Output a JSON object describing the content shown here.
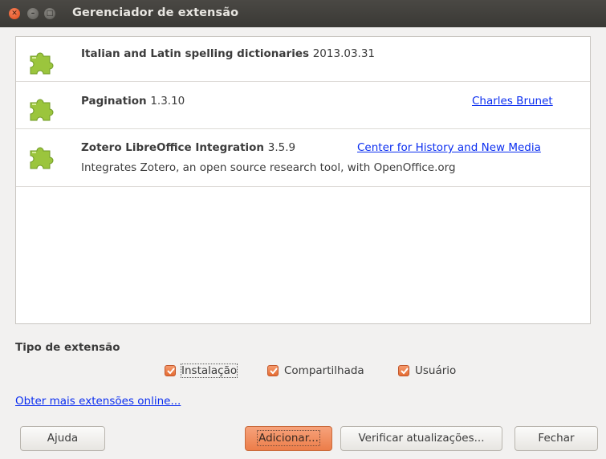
{
  "window": {
    "title": "Gerenciador de extensão",
    "controls": {
      "close_glyph": "✕",
      "minimize_glyph": "–",
      "maximize_glyph": "□"
    }
  },
  "extensions": [
    {
      "name": "Italian and Latin spelling dictionaries",
      "version": "2013.03.31",
      "publisher": "",
      "description": "",
      "icon": "puzzle-piece-icon"
    },
    {
      "name": "Pagination",
      "version": "1.3.10",
      "publisher": "Charles Brunet",
      "description": "",
      "icon": "puzzle-piece-icon"
    },
    {
      "name": "Zotero LibreOffice Integration",
      "version": "3.5.9",
      "publisher": "Center for History and New Media",
      "description": "Integrates Zotero, an open source research tool, with OpenOffice.org",
      "icon": "puzzle-piece-icon"
    }
  ],
  "filter": {
    "label": "Tipo de extensão",
    "options": [
      {
        "label": "Instalação",
        "checked": true
      },
      {
        "label": "Compartilhada",
        "checked": true
      },
      {
        "label": "Usuário",
        "checked": true
      }
    ]
  },
  "more_link": "Obter mais extensões online...",
  "buttons": {
    "help": "Ajuda",
    "add": "Adicionar...",
    "check_updates": "Verificar atualizações...",
    "close": "Fechar"
  },
  "colors": {
    "accent": "#e56c33",
    "link": "#0b2ef0",
    "puzzle_green": "#9bc53d"
  }
}
